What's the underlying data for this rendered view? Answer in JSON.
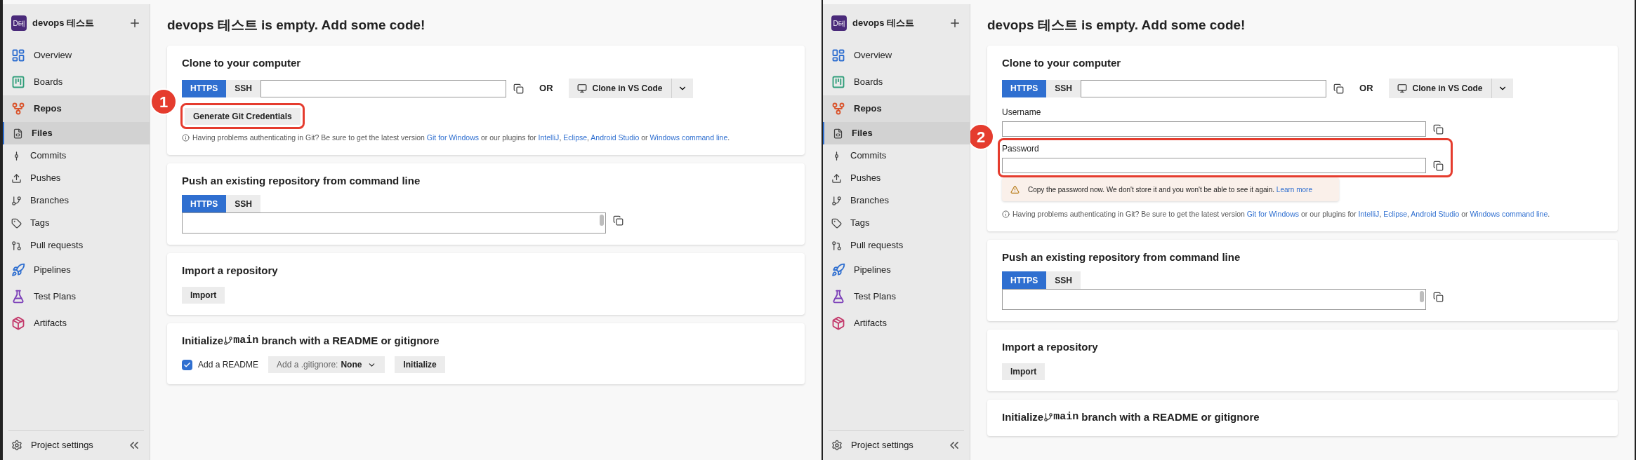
{
  "panels": [
    {
      "sidebar": {
        "project": {
          "initials": "D테",
          "name": "devops 테스트"
        },
        "items": [
          {
            "label": "Overview",
            "selected": false
          },
          {
            "label": "Boards",
            "selected": false
          },
          {
            "label": "Repos",
            "selected": false,
            "expanded": true,
            "children": [
              {
                "label": "Files",
                "selected": true
              },
              {
                "label": "Commits",
                "selected": false
              },
              {
                "label": "Pushes",
                "selected": false
              },
              {
                "label": "Branches",
                "selected": false
              },
              {
                "label": "Tags",
                "selected": false
              },
              {
                "label": "Pull requests",
                "selected": false
              }
            ]
          },
          {
            "label": "Pipelines",
            "selected": false
          },
          {
            "label": "Test Plans",
            "selected": false
          },
          {
            "label": "Artifacts",
            "selected": false
          }
        ],
        "footer": "Project settings"
      },
      "page": {
        "title": "devops 테스트 is empty. Add some code!",
        "clone": {
          "title": "Clone to your computer",
          "tabs": [
            {
              "label": "HTTPS",
              "selected": true
            },
            {
              "label": "SSH",
              "selected": false
            }
          ],
          "or": "OR",
          "vscode": "Clone in VS Code",
          "credentials": {
            "kind": "button",
            "label": "Generate Git Credentials",
            "callout": "1"
          },
          "help": [
            {
              "text": "Having problems authenticating in Git? Be sure to get the latest version "
            },
            {
              "text": "Git for Windows",
              "link": true
            },
            {
              "text": " or our plugins for "
            },
            {
              "text": "IntelliJ",
              "link": true
            },
            {
              "text": ", "
            },
            {
              "text": "Eclipse",
              "link": true
            },
            {
              "text": ", "
            },
            {
              "text": "Android Studio",
              "link": true
            },
            {
              "text": " or "
            },
            {
              "text": "Windows command line",
              "link": true
            },
            {
              "text": "."
            }
          ]
        },
        "push": {
          "title": "Push an existing repository from command line",
          "tabs": [
            {
              "label": "HTTPS",
              "selected": true
            },
            {
              "label": "SSH",
              "selected": false
            }
          ]
        },
        "import": {
          "title": "Import a repository",
          "button": "Import"
        },
        "init": {
          "title_start": "Initialize ",
          "branch": "main",
          "title_end": " branch with a README or gitignore",
          "readme": {
            "label": "Add a README",
            "checked": true
          },
          "gitignore": {
            "label": "Add a .gitignore:",
            "value": "None"
          },
          "button": "Initialize"
        }
      }
    },
    {
      "sidebar": {
        "project": {
          "initials": "D테",
          "name": "devops 테스트"
        },
        "items": [
          {
            "label": "Overview",
            "selected": false
          },
          {
            "label": "Boards",
            "selected": false
          },
          {
            "label": "Repos",
            "selected": false,
            "expanded": true,
            "children": [
              {
                "label": "Files",
                "selected": true
              },
              {
                "label": "Commits",
                "selected": false
              },
              {
                "label": "Pushes",
                "selected": false
              },
              {
                "label": "Branches",
                "selected": false
              },
              {
                "label": "Tags",
                "selected": false
              },
              {
                "label": "Pull requests",
                "selected": false
              }
            ]
          },
          {
            "label": "Pipelines",
            "selected": false
          },
          {
            "label": "Test Plans",
            "selected": false
          },
          {
            "label": "Artifacts",
            "selected": false
          }
        ],
        "footer": "Project settings"
      },
      "page": {
        "title": "devops 테스트 is empty. Add some code!",
        "clone": {
          "title": "Clone to your computer",
          "tabs": [
            {
              "label": "HTTPS",
              "selected": true
            },
            {
              "label": "SSH",
              "selected": false
            }
          ],
          "or": "OR",
          "vscode": "Clone in VS Code",
          "credentials": {
            "kind": "fields",
            "fields": [
              {
                "label": "Username"
              },
              {
                "label": "Password",
                "callout": "2"
              }
            ],
            "warning": {
              "text": "Copy the password now. We don't store it and you won't be able to see it again.",
              "link": "Learn more"
            }
          },
          "help": [
            {
              "text": "Having problems authenticating in Git? Be sure to get the latest version "
            },
            {
              "text": "Git for Windows",
              "link": true
            },
            {
              "text": " or our plugins for "
            },
            {
              "text": "IntelliJ",
              "link": true
            },
            {
              "text": ", "
            },
            {
              "text": "Eclipse",
              "link": true
            },
            {
              "text": ", "
            },
            {
              "text": "Android Studio",
              "link": true
            },
            {
              "text": " or "
            },
            {
              "text": "Windows command line",
              "link": true
            },
            {
              "text": "."
            }
          ]
        },
        "push": {
          "title": "Push an existing repository from command line",
          "tabs": [
            {
              "label": "HTTPS",
              "selected": true
            },
            {
              "label": "SSH",
              "selected": false
            }
          ]
        },
        "import": {
          "title": "Import a repository",
          "button": "Import"
        },
        "init": {
          "title_start": "Initialize ",
          "branch": "main",
          "title_end": " branch with a README or gitignore"
        }
      }
    }
  ]
}
